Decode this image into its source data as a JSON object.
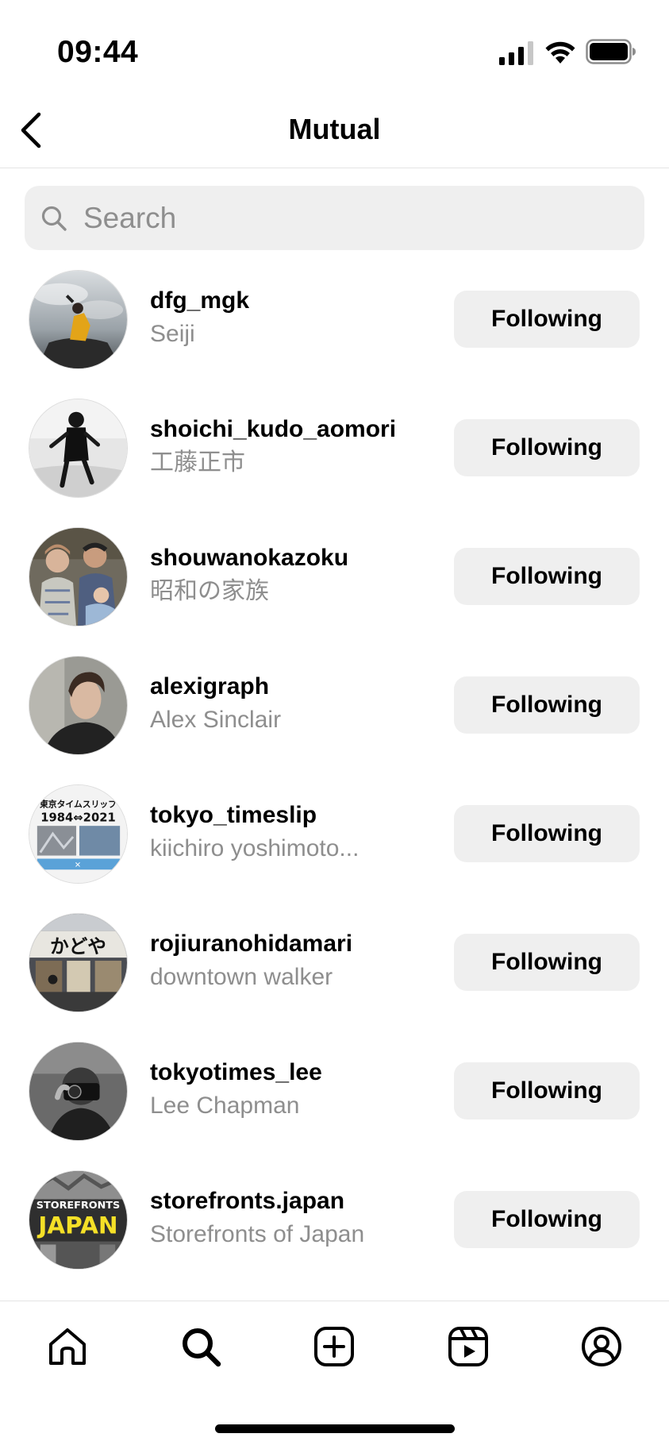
{
  "status_bar": {
    "time": "09:44"
  },
  "header": {
    "title": "Mutual"
  },
  "search": {
    "placeholder": "Search"
  },
  "users": [
    {
      "username": "dfg_mgk",
      "name": "Seiji",
      "button": "Following"
    },
    {
      "username": "shoichi_kudo_aomori",
      "name": "工藤正市",
      "button": "Following"
    },
    {
      "username": "shouwanokazoku",
      "name": "昭和の家族",
      "button": "Following"
    },
    {
      "username": "alexigraph",
      "name": "Alex Sinclair",
      "button": "Following"
    },
    {
      "username": "tokyo_timeslip",
      "name": "kiichiro yoshimoto...",
      "button": "Following",
      "avatar_text": [
        "東京タイムスリップ",
        "1984⇔2021"
      ]
    },
    {
      "username": "rojiuranohidamari",
      "name": "downtown  walker",
      "button": "Following",
      "avatar_text": [
        "かどや"
      ]
    },
    {
      "username": "tokyotimes_lee",
      "name": "Lee Chapman",
      "button": "Following"
    },
    {
      "username": "storefronts.japan",
      "name": "Storefronts of Japan",
      "button": "Following",
      "avatar_text": [
        "STOREFRONTS",
        "JAPAN"
      ]
    }
  ],
  "tabbar": {
    "icons": [
      "home-icon",
      "search-icon",
      "create-post-icon",
      "reels-icon",
      "profile-icon"
    ]
  },
  "colors": {
    "button_bg": "#efefef",
    "secondary_text": "#8e8e8e",
    "accent_yellow": "#f5e027"
  }
}
